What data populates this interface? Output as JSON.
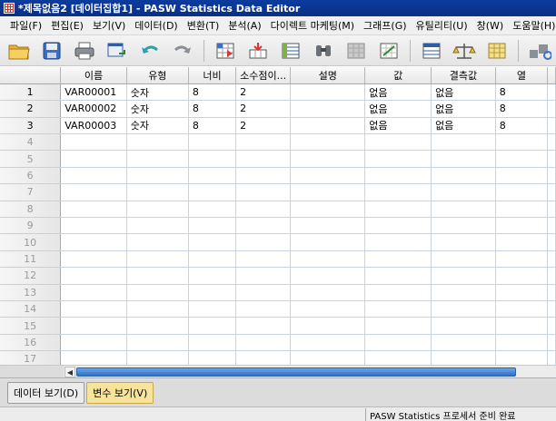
{
  "window": {
    "title": "*제목없음2 [데이터집합1] - PASW Statistics Data Editor"
  },
  "menu": [
    "파일(F)",
    "편집(E)",
    "보기(V)",
    "데이터(D)",
    "변환(T)",
    "분석(A)",
    "다이렉트 마케팅(M)",
    "그래프(G)",
    "유틸리티(U)",
    "창(W)",
    "도움말(H)"
  ],
  "toolbar": {
    "icons": [
      "open-folder-icon",
      "save-icon",
      "print-icon",
      "dialog-recall-icon",
      "undo-icon",
      "redo-icon",
      "goto-case-icon",
      "goto-variable-icon",
      "variables-icon",
      "find-icon",
      "insert-cases-icon",
      "insert-variable-icon",
      "split-file-icon",
      "weight-cases-icon",
      "select-cases-icon",
      "value-labels-icon"
    ]
  },
  "grid": {
    "columns": [
      "이름",
      "유형",
      "너비",
      "소수점이...",
      "설명",
      "값",
      "결측값",
      "열"
    ],
    "rows": [
      {
        "num": "1",
        "cells": [
          "VAR00001",
          "숫자",
          "8",
          "2",
          "",
          "없음",
          "없음",
          "8"
        ]
      },
      {
        "num": "2",
        "cells": [
          "VAR00002",
          "숫자",
          "8",
          "2",
          "",
          "없음",
          "없음",
          "8"
        ]
      },
      {
        "num": "3",
        "cells": [
          "VAR00003",
          "숫자",
          "8",
          "2",
          "",
          "없음",
          "없음",
          "8"
        ]
      },
      {
        "num": "4",
        "cells": [
          "",
          "",
          "",
          "",
          "",
          "",
          "",
          ""
        ]
      },
      {
        "num": "5",
        "cells": [
          "",
          "",
          "",
          "",
          "",
          "",
          "",
          ""
        ]
      },
      {
        "num": "6",
        "cells": [
          "",
          "",
          "",
          "",
          "",
          "",
          "",
          ""
        ]
      },
      {
        "num": "7",
        "cells": [
          "",
          "",
          "",
          "",
          "",
          "",
          "",
          ""
        ]
      },
      {
        "num": "8",
        "cells": [
          "",
          "",
          "",
          "",
          "",
          "",
          "",
          ""
        ]
      },
      {
        "num": "9",
        "cells": [
          "",
          "",
          "",
          "",
          "",
          "",
          "",
          ""
        ]
      },
      {
        "num": "10",
        "cells": [
          "",
          "",
          "",
          "",
          "",
          "",
          "",
          ""
        ]
      },
      {
        "num": "11",
        "cells": [
          "",
          "",
          "",
          "",
          "",
          "",
          "",
          ""
        ]
      },
      {
        "num": "12",
        "cells": [
          "",
          "",
          "",
          "",
          "",
          "",
          "",
          ""
        ]
      },
      {
        "num": "13",
        "cells": [
          "",
          "",
          "",
          "",
          "",
          "",
          "",
          ""
        ]
      },
      {
        "num": "14",
        "cells": [
          "",
          "",
          "",
          "",
          "",
          "",
          "",
          ""
        ]
      },
      {
        "num": "15",
        "cells": [
          "",
          "",
          "",
          "",
          "",
          "",
          "",
          ""
        ]
      },
      {
        "num": "16",
        "cells": [
          "",
          "",
          "",
          "",
          "",
          "",
          "",
          ""
        ]
      },
      {
        "num": "17",
        "cells": [
          "",
          "",
          "",
          "",
          "",
          "",
          "",
          ""
        ]
      }
    ]
  },
  "tabs": [
    {
      "label": "데이터 보기(D)",
      "active": false
    },
    {
      "label": "변수 보기(V)",
      "active": true
    }
  ],
  "status": {
    "text": "PASW Statistics 프로세서 준비 완료"
  },
  "colors": {
    "title_bar": "#0b3c9e",
    "active_tab": "#f7e39a",
    "scroll_thumb": "#2f6fc8"
  }
}
